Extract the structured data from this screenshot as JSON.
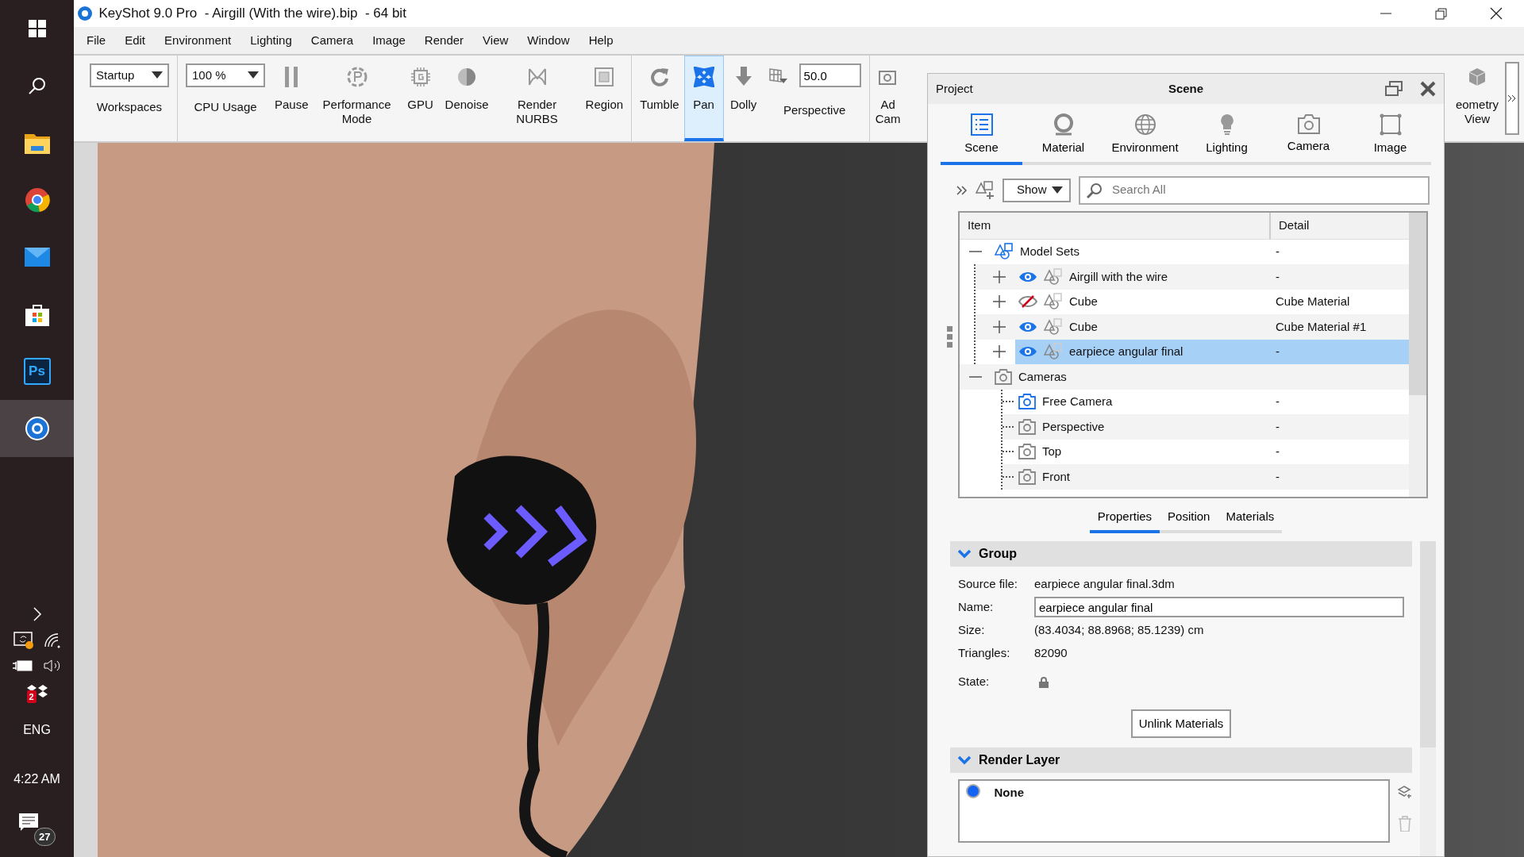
{
  "window": {
    "title": "KeyShot 9.0 Pro  - Airgill (With the wire).bip  - 64 bit"
  },
  "taskbar": {
    "apps": [
      {
        "kind": "start",
        "selected": false
      },
      {
        "kind": "search",
        "selected": false
      },
      {
        "kind": "explorer",
        "selected": false
      },
      {
        "kind": "chrome",
        "selected": false
      },
      {
        "kind": "mail",
        "selected": false
      },
      {
        "kind": "store",
        "selected": false
      },
      {
        "kind": "photoshop",
        "label": "Ps",
        "selected": false
      },
      {
        "kind": "keyshot",
        "selected": true
      }
    ],
    "tray": {
      "dropbox_badge": "2",
      "language": "ENG",
      "time": "4:22 AM",
      "notifications": "27"
    }
  },
  "menu": [
    "File",
    "Edit",
    "Environment",
    "Lighting",
    "Camera",
    "Image",
    "Render",
    "View",
    "Window",
    "Help"
  ],
  "toolbar": {
    "groups": [
      [
        {
          "kind": "dropdown",
          "value": "Startup",
          "label": "Workspaces"
        }
      ],
      [
        {
          "kind": "dropdown",
          "value": "100 %",
          "label": "CPU Usage"
        },
        {
          "kind": "tool",
          "label": "Pause",
          "selected": false
        },
        {
          "kind": "tool",
          "label": "Performance Mode",
          "selected": false
        },
        {
          "kind": "tool",
          "label": "GPU",
          "selected": false
        },
        {
          "kind": "tool",
          "label": "Denoise",
          "selected": false
        },
        {
          "kind": "tool",
          "label": "Render NURBS",
          "selected": false
        },
        {
          "kind": "tool",
          "label": "Region",
          "selected": false
        }
      ],
      [
        {
          "kind": "tool",
          "label": "Tumble",
          "selected": false
        },
        {
          "kind": "tool",
          "label": "Pan",
          "selected": true
        },
        {
          "kind": "tool",
          "label": "Dolly",
          "selected": false
        },
        {
          "kind": "field",
          "value": "50.0",
          "label": "Perspective"
        }
      ],
      [
        {
          "kind": "tool",
          "label": "Ad Cam",
          "selected": false
        }
      ]
    ],
    "trailing": {
      "label": "eometry View"
    }
  },
  "panel": {
    "section": "Project",
    "title": "Scene",
    "tabs": [
      {
        "label": "Scene",
        "selected": true
      },
      {
        "label": "Material",
        "selected": false
      },
      {
        "label": "Environment",
        "selected": false
      },
      {
        "label": "Lighting",
        "selected": false
      },
      {
        "label": "Camera",
        "selected": false
      },
      {
        "label": "Image",
        "selected": false
      }
    ],
    "filter": "Show",
    "search": {
      "placeholder": "Search All"
    },
    "tree": {
      "columns": [
        "Item",
        "Detail"
      ],
      "rows": [
        {
          "kind": "model_set",
          "label": "Model Sets",
          "detail": "-",
          "expanded": true,
          "children": [
            {
              "kind": "model",
              "label": "Airgill with the wire",
              "detail": "-",
              "expanded": false,
              "visible": true,
              "selected": false
            },
            {
              "kind": "model",
              "label": "Cube",
              "detail": "Cube Material",
              "expanded": false,
              "visible": false,
              "selected": false
            },
            {
              "kind": "model",
              "label": "Cube",
              "detail": "Cube Material #1",
              "expanded": false,
              "visible": true,
              "selected": false
            },
            {
              "kind": "model",
              "label": "earpiece angular final",
              "detail": "-",
              "expanded": false,
              "visible": true,
              "selected": true
            }
          ]
        },
        {
          "kind": "cameras",
          "label": "Cameras",
          "expanded": true,
          "children": [
            {
              "kind": "camera",
              "label": "Free Camera",
              "detail": "-",
              "active": true,
              "selected": false
            },
            {
              "kind": "camera",
              "label": "Perspective",
              "detail": "-",
              "active": false,
              "selected": false
            },
            {
              "kind": "camera",
              "label": "Top",
              "detail": "-",
              "active": false,
              "selected": false
            },
            {
              "kind": "camera",
              "label": "Front",
              "detail": "-",
              "active": false,
              "selected": false
            }
          ]
        }
      ]
    },
    "subtabs": [
      {
        "label": "Properties",
        "selected": true
      },
      {
        "label": "Position",
        "selected": false
      },
      {
        "label": "Materials",
        "selected": false
      }
    ],
    "sections": [
      {
        "kind": "group",
        "title": "Group",
        "expanded": true,
        "fields": [
          {
            "kind": "text",
            "label": "Source file:",
            "value": "earpiece angular final.3dm"
          },
          {
            "kind": "input",
            "label": "Name:",
            "value": "earpiece angular final"
          },
          {
            "kind": "text",
            "label": "Size:",
            "value": "(83.4034; 88.8968; 85.1239) cm"
          },
          {
            "kind": "text",
            "label": "Triangles:",
            "value": "82090"
          },
          {
            "kind": "lock",
            "label": "State:"
          }
        ],
        "button": "Unlink Materials"
      },
      {
        "kind": "layers",
        "title": "Render Layer",
        "expanded": true,
        "layers": [
          {
            "label": "None",
            "selected": true
          }
        ]
      }
    ]
  }
}
